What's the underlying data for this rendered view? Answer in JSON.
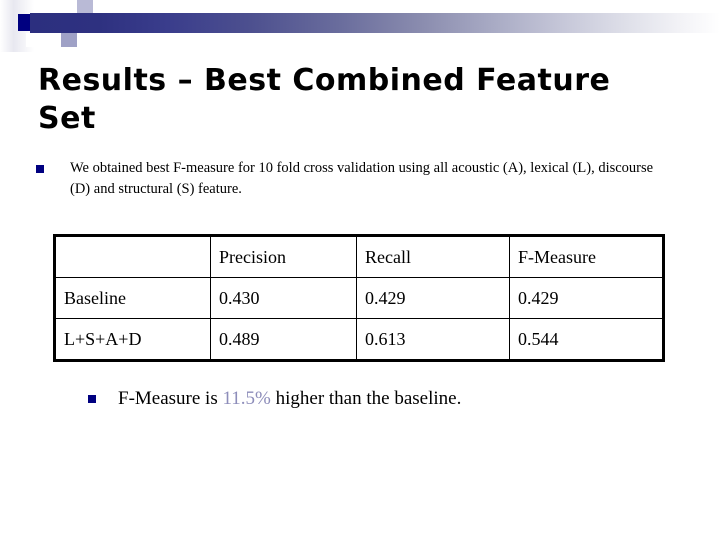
{
  "slide": {
    "title": "Results – Best Combined Feature Set",
    "bullets": [
      {
        "marker": "square-bullet",
        "text": "We obtained best F-measure for 10 fold cross validation using all acoustic (A), lexical (L), discourse (D) and structural (S) feature."
      }
    ],
    "conclusion": {
      "marker": "square-bullet",
      "prefix": "F-Measure is ",
      "highlight": "11.5%",
      "suffix": " higher than the baseline."
    }
  },
  "table": {
    "headers": [
      "",
      "Precision",
      "Recall",
      "F-Measure"
    ],
    "rows": [
      {
        "label": "Baseline",
        "values": [
          "0.430",
          "0.429",
          "0.429"
        ]
      },
      {
        "label": "L+S+A+D",
        "values": [
          "0.489",
          "0.613",
          "0.544"
        ]
      }
    ]
  },
  "colors": {
    "bullet_navy": "#000080",
    "header_yellow": "#ffffcc",
    "row_label_cyan": "#ccffff",
    "highlight_lavender": "#8d8dba",
    "gradient_start": "#2c2f7f",
    "gradient_end": "#ffffff"
  },
  "chart_data": {
    "type": "table",
    "title": "Results – Best Combined Feature Set",
    "categories": [
      "Baseline",
      "L+S+A+D"
    ],
    "metrics": [
      "Precision",
      "Recall",
      "F-Measure"
    ],
    "series": [
      {
        "name": "Precision",
        "values": [
          0.43,
          0.489
        ]
      },
      {
        "name": "Recall",
        "values": [
          0.429,
          0.613
        ]
      },
      {
        "name": "F-Measure",
        "values": [
          0.429,
          0.544
        ]
      }
    ],
    "annotations": [
      "F-Measure is 11.5% higher than the baseline."
    ],
    "xlabel": "",
    "ylabel": "",
    "ylim": [
      0,
      1
    ]
  }
}
